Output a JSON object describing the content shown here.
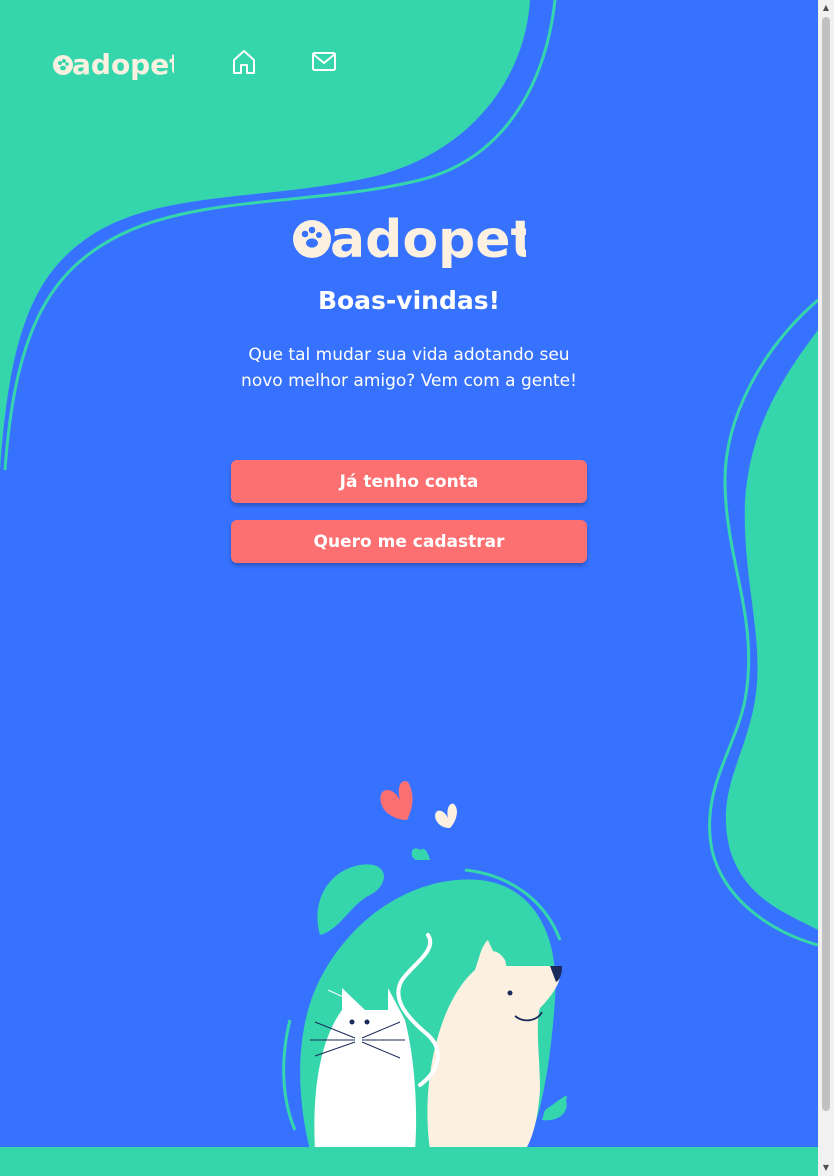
{
  "brand": {
    "name": "adopet",
    "colors": {
      "primary_blue": "#3772ff",
      "accent_green": "#36d6ad",
      "button_coral": "#fc7071",
      "cream": "#fcf1e0"
    }
  },
  "header": {
    "logo_text": "adopet",
    "nav": [
      {
        "icon": "home-icon"
      },
      {
        "icon": "mail-icon"
      }
    ]
  },
  "main": {
    "logo_text": "adopet",
    "title": "Boas-vindas!",
    "subtitle": "Que tal mudar sua vida adotando seu novo melhor amigo? Vem com a gente!",
    "buttons": {
      "login_label": "Já tenho conta",
      "signup_label": "Quero me cadastrar"
    }
  },
  "illustration": {
    "icon": "cat-and-dog-illustration"
  }
}
